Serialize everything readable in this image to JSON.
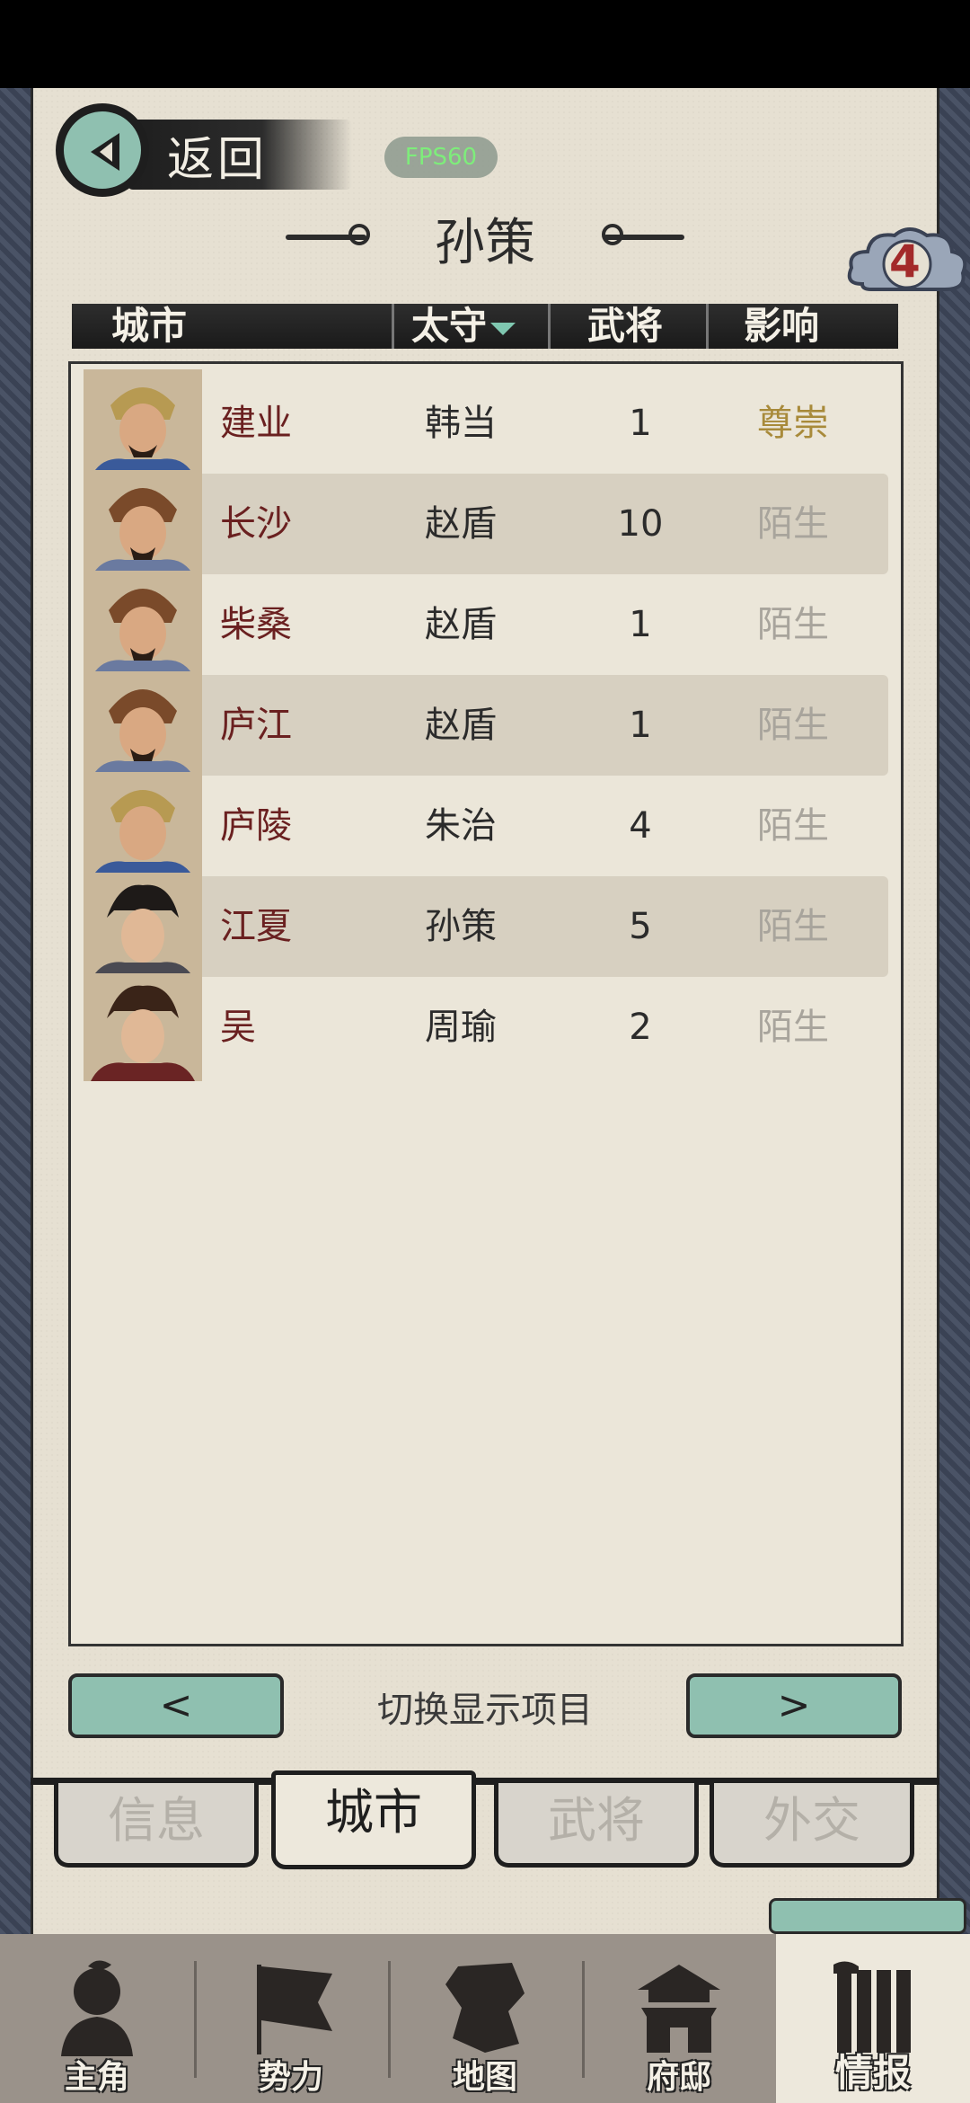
{
  "header": {
    "back_label": "返回",
    "fps": "FPS60",
    "title": "孙策",
    "badge_count": "4"
  },
  "columns": [
    "城市",
    "太守",
    "武将",
    "影响"
  ],
  "rows": [
    {
      "city": "建业",
      "governor": "韩当",
      "generals": "1",
      "influence": "尊崇",
      "influence_color": "#a88a3a"
    },
    {
      "city": "长沙",
      "governor": "赵盾",
      "generals": "10",
      "influence": "陌生",
      "influence_color": "#a8a49c"
    },
    {
      "city": "柴桑",
      "governor": "赵盾",
      "generals": "1",
      "influence": "陌生",
      "influence_color": "#a8a49c"
    },
    {
      "city": "庐江",
      "governor": "赵盾",
      "generals": "1",
      "influence": "陌生",
      "influence_color": "#a8a49c"
    },
    {
      "city": "庐陵",
      "governor": "朱治",
      "generals": "4",
      "influence": "陌生",
      "influence_color": "#a8a49c"
    },
    {
      "city": "江夏",
      "governor": "孙策",
      "generals": "5",
      "influence": "陌生",
      "influence_color": "#a8a49c"
    },
    {
      "city": "吴",
      "governor": "周瑜",
      "generals": "2",
      "influence": "陌生",
      "influence_color": "#a8a49c"
    }
  ],
  "switcher": {
    "prev": "<",
    "next": ">",
    "label": "切换显示项目"
  },
  "tabs": [
    "信息",
    "城市",
    "武将",
    "外交"
  ],
  "nav": [
    "主角",
    "势力",
    "地图",
    "府邸",
    "情报"
  ]
}
